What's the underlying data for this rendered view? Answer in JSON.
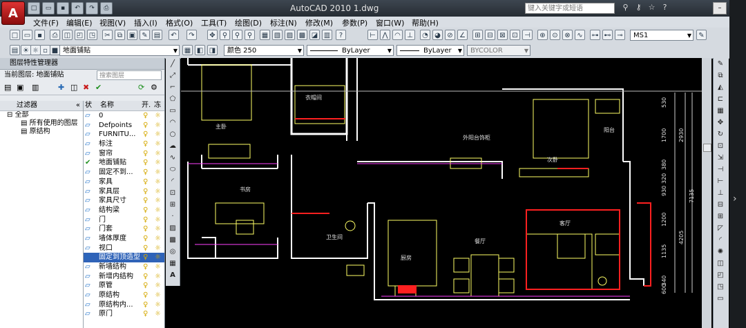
{
  "titlebar": {
    "app_logo": "A",
    "title": "AutoCAD 2010    1.dwg",
    "search_placeholder": "键入关键字或短语",
    "icons": [
      "binoculars-icon",
      "key-icon",
      "star-icon",
      "help-icon"
    ],
    "qat_icons": [
      "new-icon",
      "open-icon",
      "save-icon",
      "undo-icon",
      "redo-icon",
      "print-icon"
    ]
  },
  "menubar": {
    "items": [
      "文件(F)",
      "编辑(E)",
      "视图(V)",
      "插入(I)",
      "格式(O)",
      "工具(T)",
      "绘图(D)",
      "标注(N)",
      "修改(M)",
      "参数(P)",
      "窗口(W)",
      "帮助(H)"
    ]
  },
  "toolbar1": {
    "workspace": "MS1"
  },
  "toolbar2": {
    "layer_combo": "地面铺贴",
    "color_combo": "颜色 250",
    "linetype_combo": "ByLayer",
    "lineweight_combo": "ByLayer",
    "plotstyle_combo": "BYCOLOR"
  },
  "layer_palette": {
    "title": "图层特性管理器",
    "current_label": "当前图层: 地面铺贴",
    "search_placeholder": "搜索图层",
    "filter_header": "过滤器",
    "tree": [
      "全部",
      "所有使用的图层",
      "原结构"
    ],
    "columns": {
      "status": "状",
      "name": "名称",
      "on": "开.",
      "freeze": "冻"
    },
    "layers": [
      {
        "name": "0",
        "current": false
      },
      {
        "name": "Defpoints",
        "current": false
      },
      {
        "name": "FURNITU...",
        "current": false
      },
      {
        "name": "标注",
        "current": false
      },
      {
        "name": "窗帘",
        "current": false
      },
      {
        "name": "地面铺贴",
        "current": true
      },
      {
        "name": "固定不到...",
        "current": false
      },
      {
        "name": "家具",
        "current": false
      },
      {
        "name": "家具层",
        "current": false
      },
      {
        "name": "家具尺寸",
        "current": false
      },
      {
        "name": "结构梁",
        "current": false
      },
      {
        "name": "门",
        "current": false
      },
      {
        "name": "门套",
        "current": false
      },
      {
        "name": "墙体厚度",
        "current": false
      },
      {
        "name": "视口",
        "current": false
      },
      {
        "name": "固定到顶造型",
        "current": false,
        "selected": true
      },
      {
        "name": "新墙结构",
        "current": false
      },
      {
        "name": "新增内结构",
        "current": false
      },
      {
        "name": "原管",
        "current": false
      },
      {
        "name": "原结构",
        "current": false
      },
      {
        "name": "原结构内...",
        "current": false
      },
      {
        "name": "原门",
        "current": false
      }
    ]
  },
  "drawing": {
    "room_labels": [
      "主卧",
      "衣帽间",
      "外阳台饰柜",
      "次卧",
      "阳台",
      "书房",
      "卫生间",
      "厨房",
      "餐厅",
      "客厅"
    ],
    "dimensions_right": [
      "530",
      "1700",
      "2930",
      "380",
      "320",
      "930",
      "7135",
      "1200",
      "4205",
      "1135",
      "340",
      "600"
    ]
  },
  "colors": {
    "wall": "#ffffff",
    "furniture": "#ffff66",
    "hatch_red": "#ff2020",
    "magenta": "#ff40ff",
    "dimension": "#d0d0d0"
  }
}
